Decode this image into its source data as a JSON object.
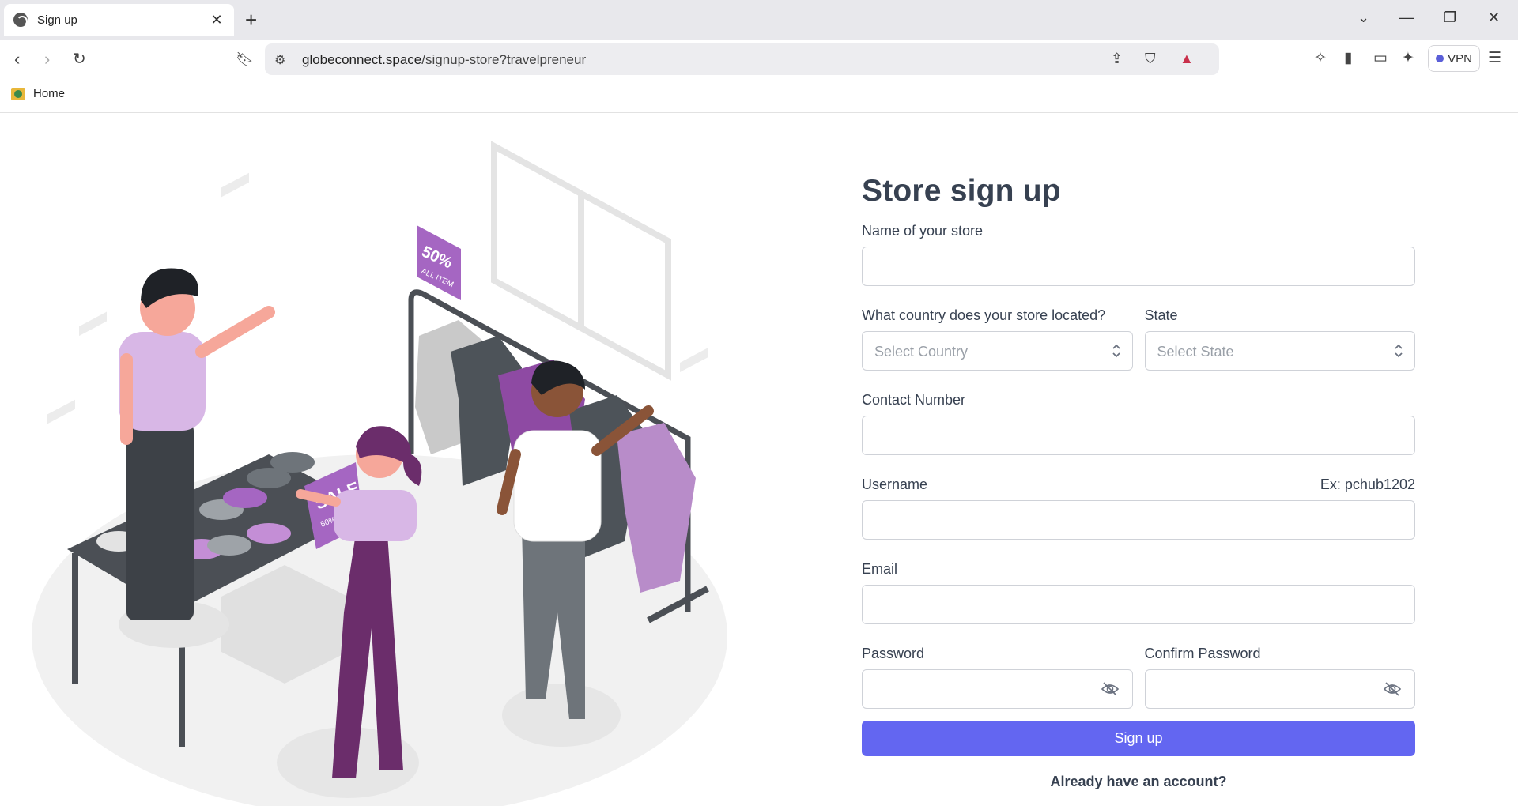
{
  "browser": {
    "tab_title": "Sign up",
    "url_host": "globeconnect.space",
    "url_path": "/signup-store?travelpreneur",
    "vpn_label": "VPN",
    "bookmark_home": "Home"
  },
  "illustration": {
    "sign_50": "50%",
    "sign_all_item": "ALL ITEM",
    "sale": "SALE",
    "sale_sub": "50% OFF"
  },
  "form": {
    "title": "Store sign up",
    "store_name_label": "Name of your store",
    "country_label": "What country does your store located?",
    "country_placeholder": "Select Country",
    "state_label": "State",
    "state_placeholder": "Select State",
    "contact_label": "Contact Number",
    "username_label": "Username",
    "username_hint": "Ex: pchub1202",
    "email_label": "Email",
    "password_label": "Password",
    "confirm_password_label": "Confirm Password",
    "submit_label": "Sign up",
    "login_link": "Already have an account?"
  },
  "colors": {
    "primary": "#6366f1",
    "accent_purple": "#a566c2",
    "dark": "#374151"
  }
}
